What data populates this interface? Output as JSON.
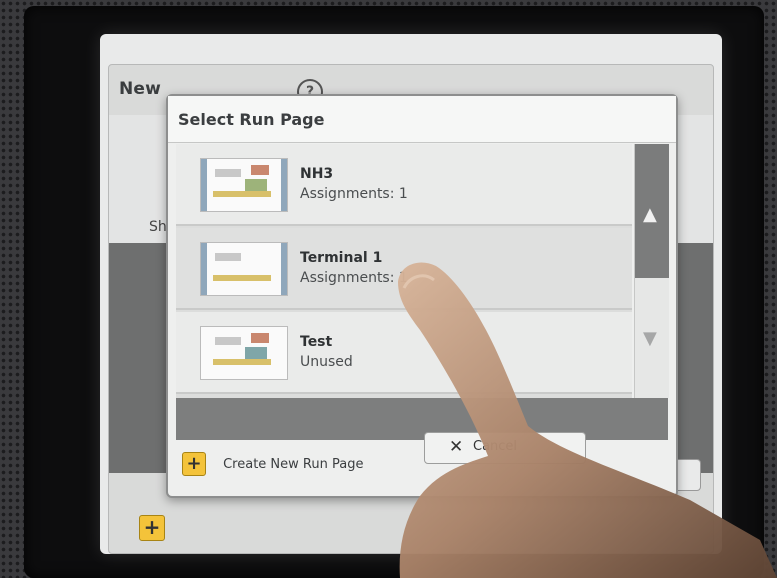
{
  "background_window": {
    "title": "New",
    "help_icon": "?",
    "side_text": "Sh",
    "add_icon": "+"
  },
  "dialog": {
    "title": "Select Run Page",
    "items": [
      {
        "name": "NH3",
        "status": "Assignments: 1"
      },
      {
        "name": "Terminal 1",
        "status": "Assignments: 1"
      },
      {
        "name": "Test",
        "status": "Unused"
      }
    ],
    "scroll_up_icon": "▲",
    "scroll_down_icon": "▼",
    "create_icon": "+",
    "create_label": "Create New Run Page",
    "cancel_icon": "✕",
    "cancel_label": "Cancel"
  },
  "colors": {
    "accent_yellow": "#f4c33a",
    "panel_gray": "#eaebea",
    "dark_band": "#6e6f6f"
  }
}
